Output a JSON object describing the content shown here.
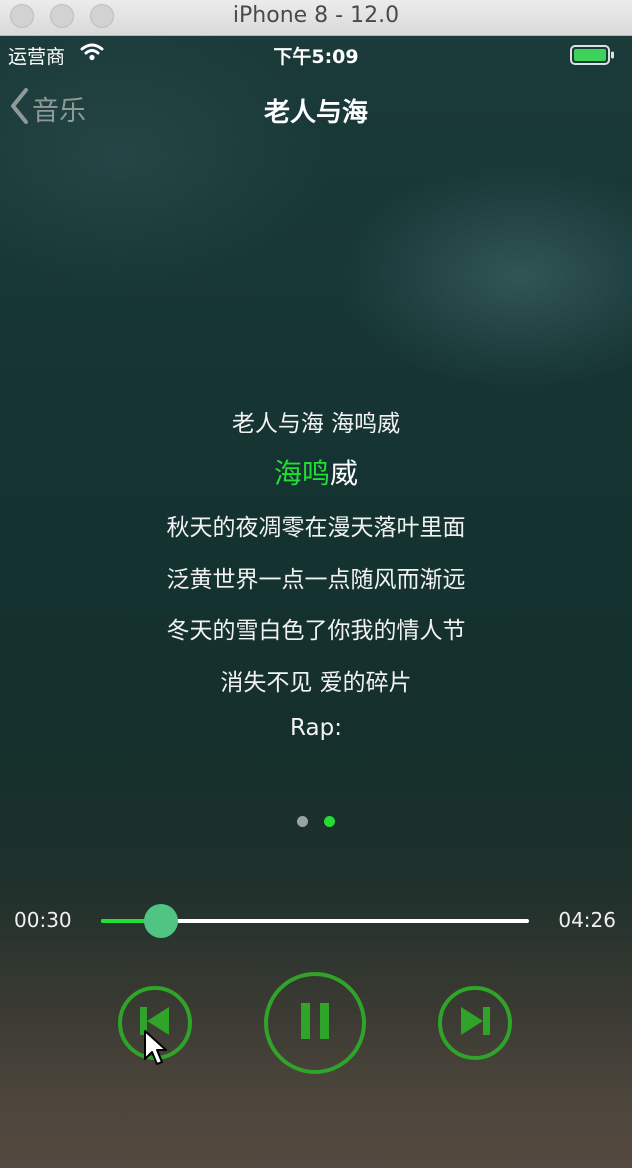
{
  "simulator": {
    "window_title": "iPhone 8 - 12.0"
  },
  "status_bar": {
    "carrier": "运营商",
    "time": "下午5:09",
    "battery_level": 1.0,
    "icons": [
      "wifi-icon",
      "battery-icon"
    ]
  },
  "nav": {
    "back_label": "音乐",
    "title": "老人与海",
    "back_icon": "chevron-left-icon"
  },
  "lyrics": {
    "lines": [
      "老人与海 海鸣威",
      "秋天的夜凋零在漫天落叶里面",
      "泛黄世界一点一点随风而渐远",
      "冬天的雪白色了你我的情人节",
      "消失不见 爱的碎片",
      "Rap:"
    ],
    "current_sung": "海鸣",
    "current_unsung": "威",
    "current_progress": 0.67
  },
  "pager": {
    "page_count": 2,
    "active_page": 2
  },
  "player": {
    "elapsed": "00:30",
    "duration": "04:26",
    "progress": 0.14,
    "controls": [
      "previous-icon",
      "pause-icon",
      "next-icon"
    ]
  },
  "colors": {
    "accent_green": "#22dd33",
    "control_green": "#2fa32a",
    "thumb": "#4fc483",
    "dot_inactive": "#9aa3a2"
  }
}
